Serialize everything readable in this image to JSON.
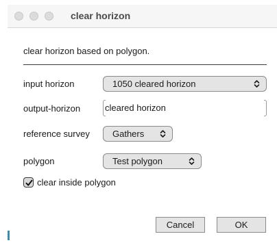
{
  "window": {
    "title": "clear horizon"
  },
  "description": "clear horizon based on polygon.",
  "fields": {
    "input_horizon": {
      "label": "input horizon",
      "value": "1050 cleared horizon"
    },
    "output_horizon": {
      "label": "output-horizon",
      "value": "cleared horizon"
    },
    "reference_survey": {
      "label": "reference survey",
      "value": "Gathers"
    },
    "polygon": {
      "label": "polygon",
      "value": "Test polygon"
    }
  },
  "options": {
    "clear_inside": {
      "label": "clear inside polygon",
      "checked": true
    }
  },
  "buttons": {
    "cancel": "Cancel",
    "ok": "OK"
  },
  "colors": {
    "accent_edge": "#3a8fa6",
    "control_fill": "#e4e4e4"
  }
}
